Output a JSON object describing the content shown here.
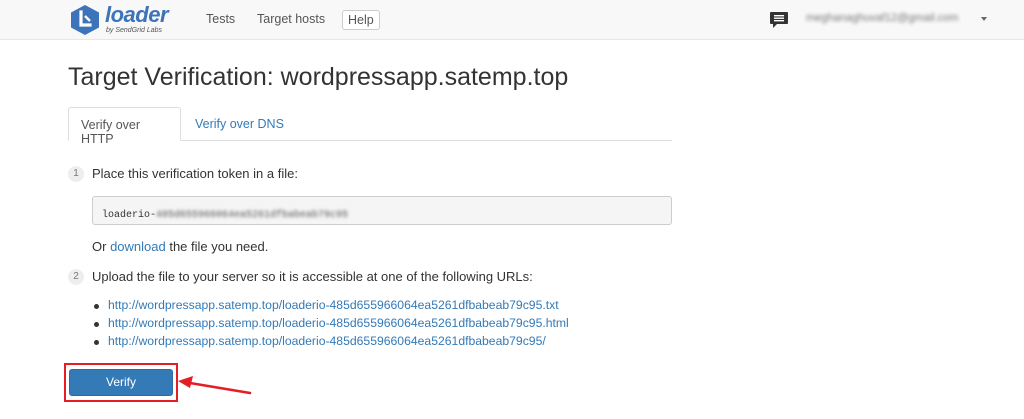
{
  "navbar": {
    "logo_text": "loader",
    "logo_sub": "by SendGrid Labs",
    "links": [
      {
        "label": "Tests"
      },
      {
        "label": "Target hosts"
      }
    ],
    "help_label": "Help",
    "user_email": "meghanaghuvaf12@gmail.com",
    "icons": [
      "chat-icon",
      "caret-down-icon"
    ]
  },
  "page": {
    "title": "Target Verification: wordpressapp.satemp.top"
  },
  "tabs": [
    {
      "label": "Verify over HTTP",
      "active": true
    },
    {
      "label": "Verify over DNS",
      "active": false
    }
  ],
  "step1": {
    "number": "1",
    "text": "Place this verification token in a file:",
    "token_prefix": "loaderio-",
    "token_secret": "485d655966064ea5261dfbabeab79c95",
    "download_prefix": "Or ",
    "download_link": "download",
    "download_suffix": " the file you need."
  },
  "step2": {
    "number": "2",
    "text": "Upload the file to your server so it is accessible at one of the following URLs:",
    "urls": [
      "http://wordpressapp.satemp.top/loaderio-485d655966064ea5261dfbabeab79c95.txt",
      "http://wordpressapp.satemp.top/loaderio-485d655966064ea5261dfbabeab79c95.html",
      "http://wordpressapp.satemp.top/loaderio-485d655966064ea5261dfbabeab79c95/"
    ]
  },
  "verify_label": "Verify",
  "colors": {
    "brand": "#3d73b9",
    "link": "#337ab7",
    "button": "#337ab7",
    "annotation": "#e31e24"
  }
}
